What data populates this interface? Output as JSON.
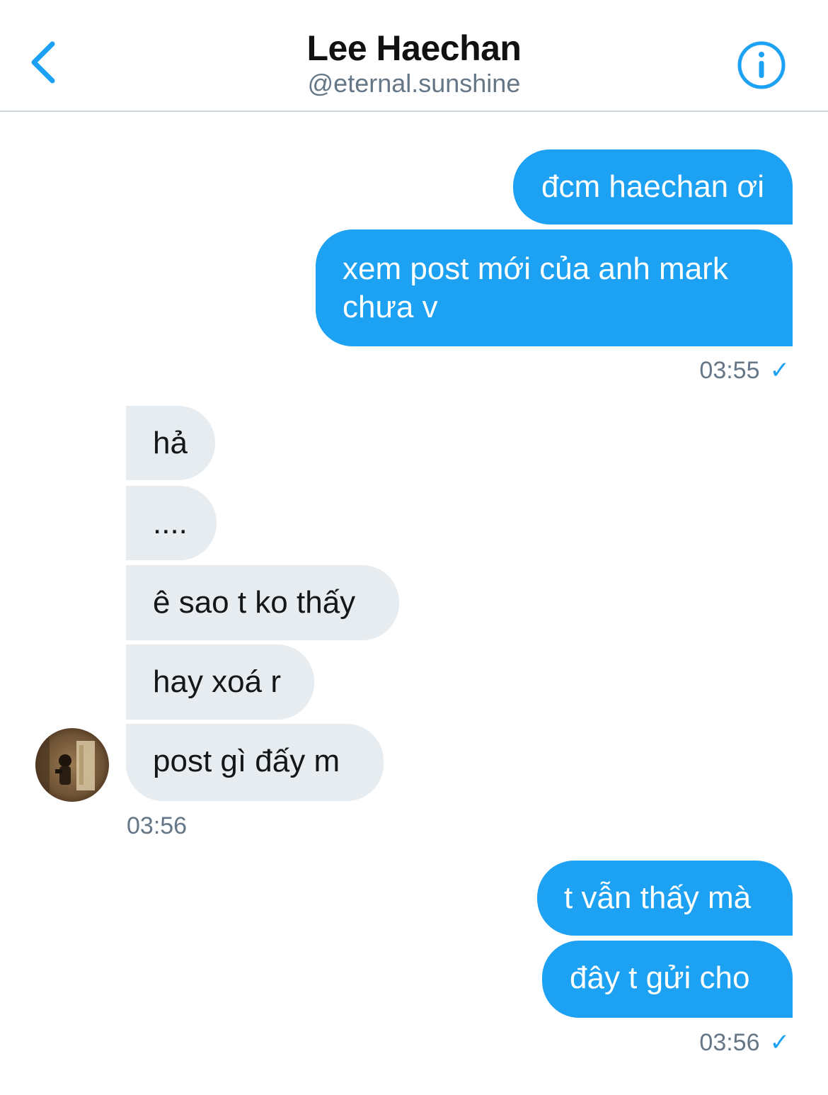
{
  "header": {
    "name": "Lee Haechan",
    "handle": "@eternal.sunshine"
  },
  "messages": {
    "group1": {
      "m1": "đcm haechan ơi",
      "m2_line1": "xem post mới của anh mark",
      "m2_line2": "chưa v",
      "time": "03:55",
      "status": "✓"
    },
    "group2": {
      "m1": "hả",
      "m2": "....",
      "m3": "ê sao t ko thấy",
      "m4": "hay xoá r",
      "m5": "post gì đấy m",
      "time": "03:56"
    },
    "group3": {
      "m1": "t vẫn thấy mà",
      "m2": "đây t gửi cho",
      "time": "03:56",
      "status": "✓"
    }
  },
  "colors": {
    "accent": "#1da1f2",
    "received_bubble": "#e6ecf0",
    "secondary_text": "#657786"
  }
}
